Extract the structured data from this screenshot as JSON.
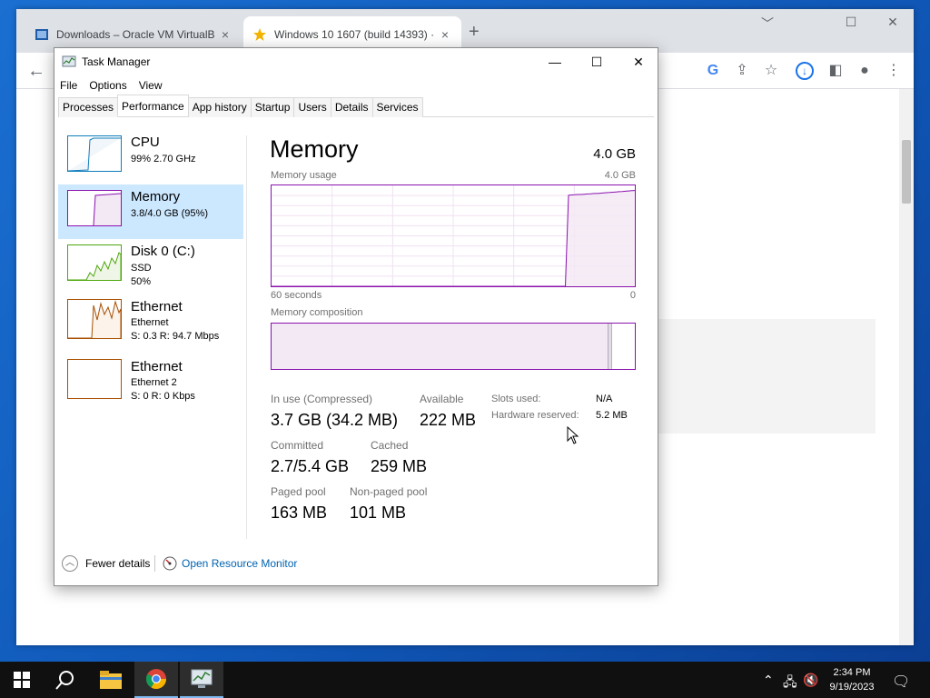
{
  "browser": {
    "tabs": [
      {
        "title": "Downloads – Oracle VM VirtualB",
        "close": "×"
      },
      {
        "title": "Windows 10 1607 (build 14393) ·",
        "close": "×"
      }
    ],
    "new_tab": "+",
    "controls": {
      "minimize": "﹀",
      "restore": "☐",
      "close": "✕"
    },
    "toolbar_icons": [
      "google-icon",
      "share-icon",
      "star-icon",
      "download-icon",
      "sidebar-icon",
      "profile-icon",
      "menu-icon"
    ]
  },
  "task_manager": {
    "title": "Task Manager",
    "window_controls": {
      "minimize": "—",
      "maximize": "☐",
      "close": "✕"
    },
    "menu": [
      "File",
      "Options",
      "View"
    ],
    "tabs": [
      "Processes",
      "Performance",
      "App history",
      "Startup",
      "Users",
      "Details",
      "Services"
    ],
    "selected_tab": "Performance",
    "sidebar": [
      {
        "name": "CPU",
        "line1": "99%  2.70 GHz",
        "line2": "",
        "line3": ""
      },
      {
        "name": "Memory",
        "line1": "3.8/4.0 GB (95%)",
        "line2": "",
        "line3": ""
      },
      {
        "name": "Disk 0 (C:)",
        "line1": "SSD",
        "line2": "50%",
        "line3": ""
      },
      {
        "name": "Ethernet",
        "line1": "Ethernet",
        "line2": "S: 0.3  R: 94.7 Mbps",
        "line3": ""
      },
      {
        "name": "Ethernet",
        "line1": "Ethernet 2",
        "line2": "S: 0  R: 0 Kbps",
        "line3": ""
      }
    ],
    "main": {
      "title": "Memory",
      "total": "4.0 GB",
      "usage_label": "Memory usage",
      "usage_max": "4.0 GB",
      "time_left": "60 seconds",
      "time_right": "0",
      "composition_label": "Memory composition",
      "stats": {
        "in_use_label": "In use (Compressed)",
        "in_use_value": "3.7 GB (34.2 MB)",
        "available_label": "Available",
        "available_value": "222 MB",
        "committed_label": "Committed",
        "committed_value": "2.7/5.4 GB",
        "cached_label": "Cached",
        "cached_value": "259 MB",
        "paged_label": "Paged pool",
        "paged_value": "163 MB",
        "nonpaged_label": "Non-paged pool",
        "nonpaged_value": "101 MB"
      },
      "details": {
        "slots_label": "Slots used:",
        "slots_value": "N/A",
        "hw_label": "Hardware reserved:",
        "hw_value": "5.2 MB"
      }
    },
    "footer": {
      "fewer_details": "Fewer details",
      "open_monitor": "Open Resource Monitor"
    }
  },
  "taskbar": {
    "clock_time": "2:34 PM",
    "clock_date": "9/19/2023",
    "tray_icons": [
      "chevron-up-icon",
      "network-icon",
      "volume-muted-icon",
      "notification-icon"
    ]
  },
  "colors": {
    "memory": "#8b12ae",
    "cpu": "#117dbb",
    "disk": "#4da60c",
    "ethernet": "#a74f01",
    "selection": "#cce8ff"
  },
  "chart_data": {
    "type": "area",
    "title": "Memory usage",
    "x_range": [
      "60 seconds",
      "0"
    ],
    "ylim": [
      0,
      4.0
    ],
    "y_unit": "GB",
    "series": [
      {
        "values": [
          0,
          0,
          0,
          0,
          0,
          0,
          0,
          0,
          0,
          0,
          0,
          0,
          0,
          0,
          0,
          0,
          0,
          0,
          0,
          0,
          0,
          0,
          0,
          0,
          0,
          0,
          0,
          0,
          0,
          0,
          0,
          0,
          0,
          0,
          0,
          0,
          0,
          0,
          0,
          0,
          0,
          0,
          0,
          0,
          0,
          0,
          0,
          0,
          0,
          0,
          0,
          0,
          0,
          0,
          0,
          0,
          0,
          0,
          0,
          0,
          0,
          0,
          0,
          0,
          0,
          0,
          0,
          0,
          0,
          0,
          0,
          0,
          0,
          0,
          0,
          0,
          0,
          0,
          0,
          0,
          0,
          0,
          0,
          0,
          0,
          0,
          0,
          0,
          0,
          0,
          0,
          0,
          0,
          0,
          3.61,
          3.62,
          3.63,
          3.64,
          3.64,
          3.65,
          3.66,
          3.67,
          3.68,
          3.68,
          3.69,
          3.7,
          3.71,
          3.72,
          3.73,
          3.74,
          3.75,
          3.76,
          3.77,
          3.78,
          3.79,
          3.8
        ]
      }
    ],
    "composition_gb": {
      "in_use": 3.7,
      "modified": 0.02,
      "standby": 0.26,
      "free": 0.02
    }
  }
}
